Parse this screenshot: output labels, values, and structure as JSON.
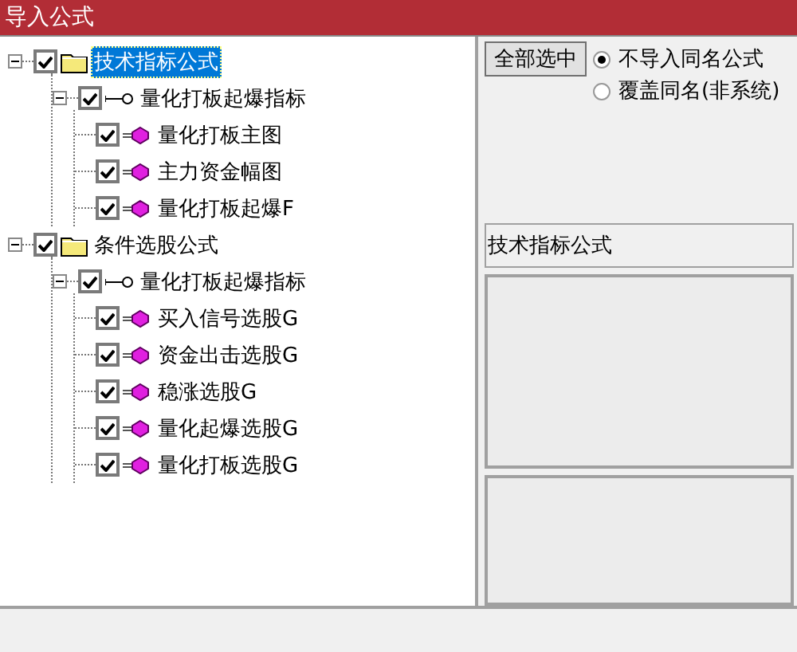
{
  "window": {
    "title": "导入公式"
  },
  "tree": [
    {
      "label": "技术指标公式",
      "kind": "folder",
      "checked": true,
      "expanded": true,
      "selected": true,
      "children": [
        {
          "label": "量化打板起爆指标",
          "kind": "key",
          "checked": true,
          "expanded": true,
          "selected": false,
          "children": [
            {
              "label": "量化打板主图",
              "kind": "gem",
              "checked": true,
              "selected": false
            },
            {
              "label": "主力资金幅图",
              "kind": "gem",
              "checked": true,
              "selected": false
            },
            {
              "label": "量化打板起爆F",
              "kind": "gem",
              "checked": true,
              "selected": false
            }
          ]
        }
      ]
    },
    {
      "label": "条件选股公式",
      "kind": "folder",
      "checked": true,
      "expanded": true,
      "selected": false,
      "children": [
        {
          "label": "量化打板起爆指标",
          "kind": "key",
          "checked": true,
          "expanded": true,
          "selected": false,
          "children": [
            {
              "label": "买入信号选股G",
              "kind": "gem",
              "checked": true,
              "selected": false
            },
            {
              "label": "资金出击选股G",
              "kind": "gem",
              "checked": true,
              "selected": false
            },
            {
              "label": "稳涨选股G",
              "kind": "gem",
              "checked": true,
              "selected": false
            },
            {
              "label": "量化起爆选股G",
              "kind": "gem",
              "checked": true,
              "selected": false
            },
            {
              "label": "量化打板选股G",
              "kind": "gem",
              "checked": true,
              "selected": false
            }
          ]
        }
      ]
    }
  ],
  "select_all_button": "全部选中",
  "options": [
    {
      "label": "不导入同名公式",
      "selected": true
    },
    {
      "label": "覆盖同名(非系统)",
      "selected": false
    }
  ],
  "info_box": "技术指标公式"
}
